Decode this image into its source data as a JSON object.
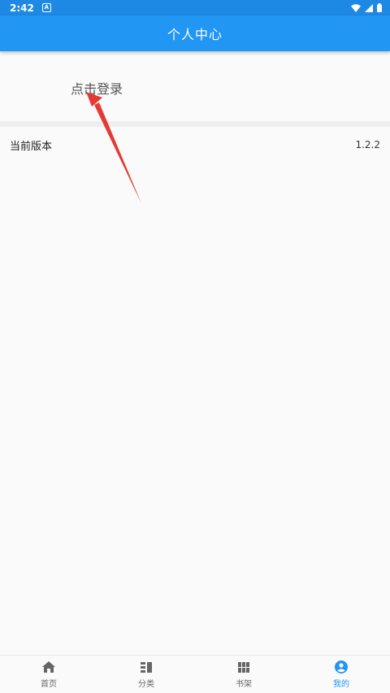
{
  "status_bar": {
    "time": "2:42",
    "notification_icon": "A"
  },
  "app_bar": {
    "title": "个人中心"
  },
  "login": {
    "label": "点击登录"
  },
  "settings": {
    "version_label": "当前版本",
    "version_value": "1.2.2"
  },
  "bottom_nav": {
    "items": [
      {
        "label": "首页",
        "icon": "home-icon"
      },
      {
        "label": "分类",
        "icon": "category-icon"
      },
      {
        "label": "书架",
        "icon": "bookshelf-icon"
      },
      {
        "label": "我的",
        "icon": "account-icon",
        "active": true
      }
    ]
  },
  "colors": {
    "primary": "#2196f3",
    "status_bar": "#1e88e5",
    "annotation_arrow": "#e53935"
  }
}
